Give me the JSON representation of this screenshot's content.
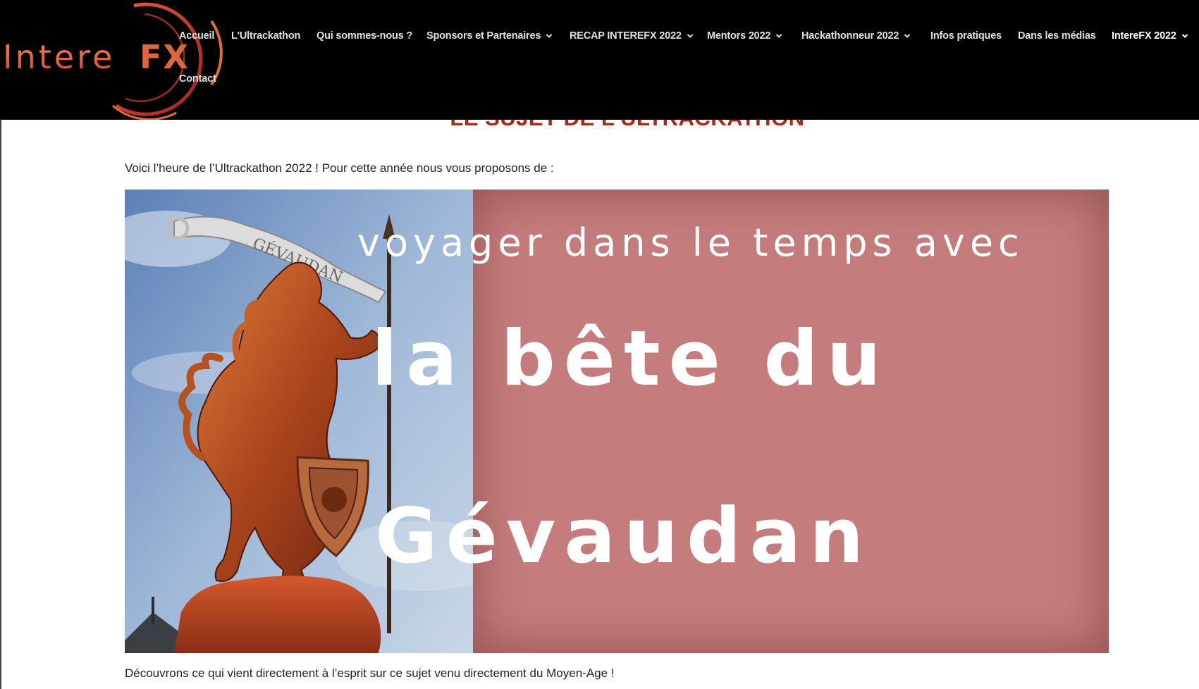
{
  "logo": {
    "text_left": "Intere",
    "text_right": "FX"
  },
  "nav": {
    "items": [
      {
        "label": "Accueil",
        "dropdown": false
      },
      {
        "label": "L'Ultrackathon",
        "dropdown": false
      },
      {
        "label": "Qui sommes-nous ?",
        "dropdown": false
      },
      {
        "label": "Sponsors et Partenaires",
        "dropdown": true
      },
      {
        "label": "RECAP INTEREFX 2022",
        "dropdown": true
      },
      {
        "label": "Mentors 2022",
        "dropdown": true
      },
      {
        "label": "Hackathonneur 2022",
        "dropdown": true
      },
      {
        "label": "Infos pratiques",
        "dropdown": false
      },
      {
        "label": "Dans les médias",
        "dropdown": false
      },
      {
        "label": "IntereFX 2022",
        "dropdown": true,
        "active": true
      },
      {
        "label": "Contact",
        "dropdown": false
      }
    ]
  },
  "content": {
    "section_title": "LE SUJET DE L'ULTRACKATHON",
    "intro": "Voici l’heure de l’Ultrackathon 2022 ! Pour cette année nous vous proposons de :",
    "banner": {
      "line1": "voyager dans le temps avec",
      "line2": "la bête du",
      "line3": "Gévaudan",
      "ribbon_text": "GÉVAUDAN"
    },
    "outro": "Découvrons ce qui vient directement à l’esprit sur ce sujet venu directement du Moyen-Age !"
  },
  "colors": {
    "header_bg": "#000000",
    "title_red": "#b22318",
    "banner_pink": "#c57c7d",
    "logo_orange": "#e0643c"
  },
  "icons": {
    "dropdown": "chevron-down-icon"
  }
}
